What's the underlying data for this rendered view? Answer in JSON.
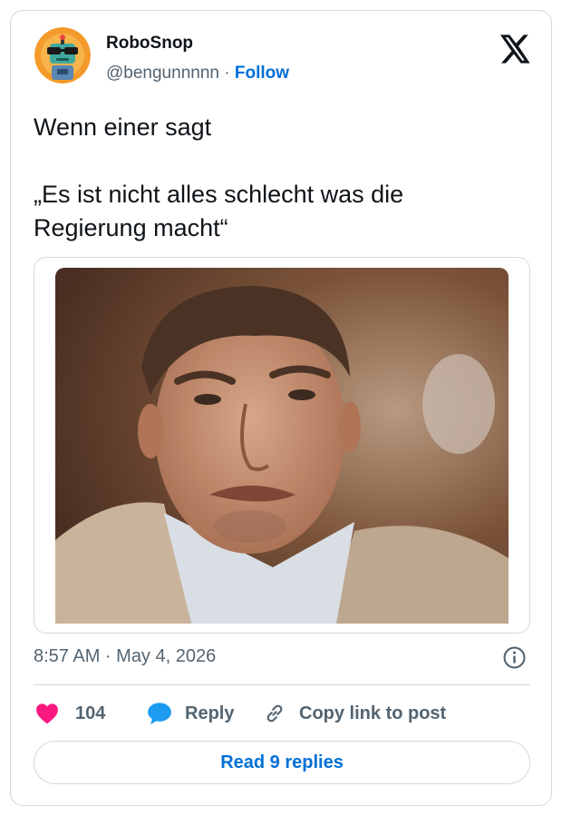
{
  "author": {
    "name": "RoboSnop",
    "handle": "@bengunnnnn",
    "separator": " · ",
    "follow_label": "Follow"
  },
  "tweet": {
    "lines": [
      "Wenn einer sagt",
      "„Es ist nicht alles schlecht was die Regierung macht“"
    ]
  },
  "meta": {
    "timestamp": "8:57 AM · May 4, 2026"
  },
  "actions": {
    "likes_count": "104",
    "reply_label": "Reply",
    "copy_label": "Copy link to post"
  },
  "footer": {
    "read_replies_label": "Read 9 replies"
  },
  "icons": {
    "platform": "x-logo-icon",
    "like": "heart-icon",
    "reply": "speech-bubble-icon",
    "copy": "link-icon",
    "info": "info-icon"
  },
  "colors": {
    "accent": "#006fd6",
    "like": "#f91880",
    "reply": "#1d9bf0",
    "secondary_text": "#536471",
    "border": "#cfd9de"
  }
}
